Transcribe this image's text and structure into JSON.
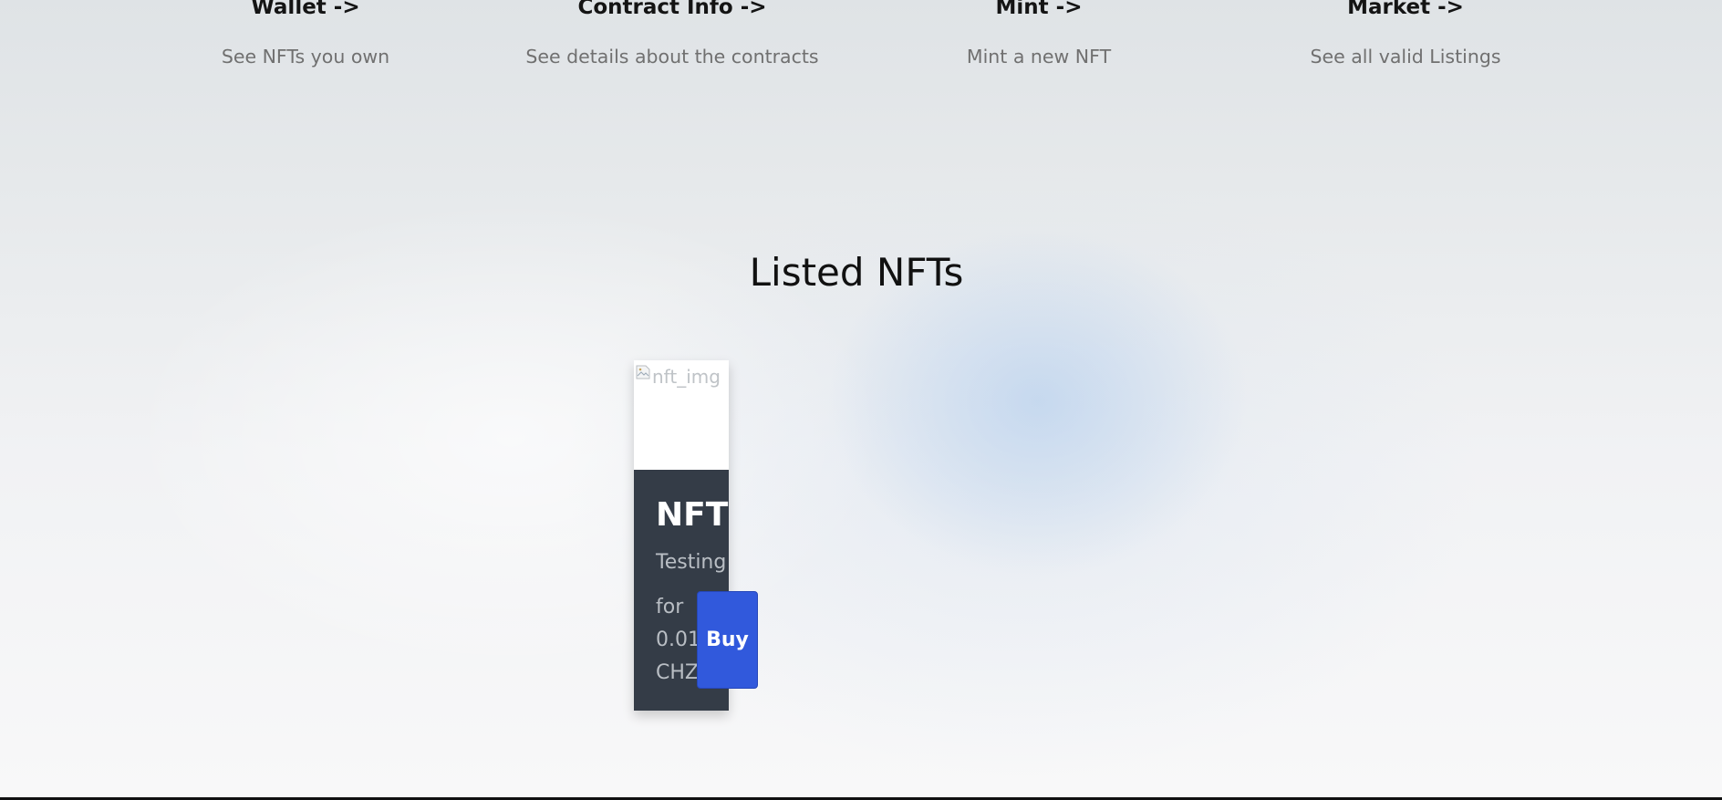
{
  "nav": [
    {
      "title": "Wallet ->",
      "description": "See NFTs you own"
    },
    {
      "title": "Contract Info ->",
      "description": "See details about the contracts"
    },
    {
      "title": "Mint ->",
      "description": "Mint a new NFT"
    },
    {
      "title": "Market ->",
      "description": "See all valid Listings"
    }
  ],
  "section": {
    "title": "Listed NFTs"
  },
  "listing": {
    "image_alt": "nft_img",
    "name": "NFT",
    "description": "Testing",
    "price_words": [
      "for",
      "0.01",
      "CHZ"
    ],
    "buy_label": "Buy"
  },
  "colors": {
    "card_body": "#343c47",
    "buy_button": "#3159dc",
    "accent_glow": "#bed4ee"
  },
  "icons": {
    "broken_image": "broken-image-icon"
  }
}
